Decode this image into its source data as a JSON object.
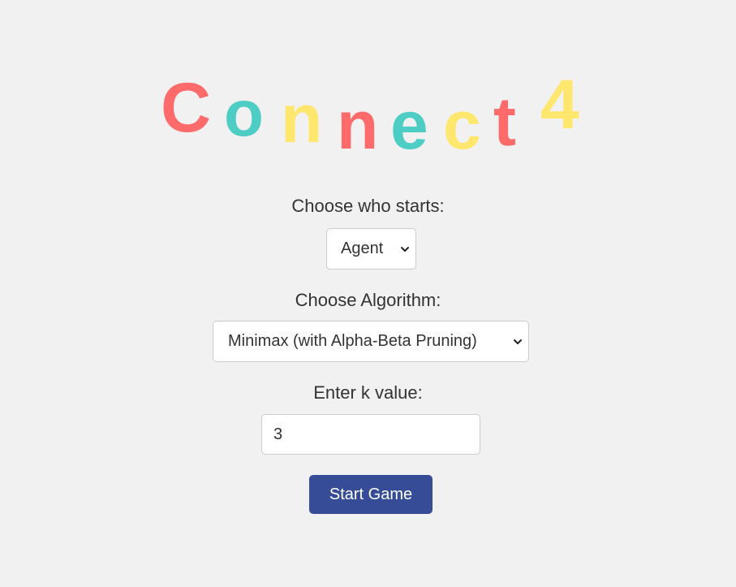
{
  "title": {
    "letters": [
      "C",
      "o",
      "n",
      "n",
      "e",
      "c",
      "t",
      "4"
    ]
  },
  "colors": {
    "red": "#ff6b6b",
    "teal": "#4ecdc4",
    "yellow": "#ffe66d",
    "button": "#364c97",
    "background": "#f1f1f1"
  },
  "starter": {
    "label": "Choose who starts:",
    "selected": "Agent",
    "icon": "chevron-down-icon"
  },
  "algorithm": {
    "label": "Choose Algorithm:",
    "selected": "Minimax (with Alpha-Beta Pruning)",
    "icon": "chevron-down-icon"
  },
  "k": {
    "label": "Enter k value:",
    "value": "3"
  },
  "start_button": {
    "label": "Start Game"
  }
}
